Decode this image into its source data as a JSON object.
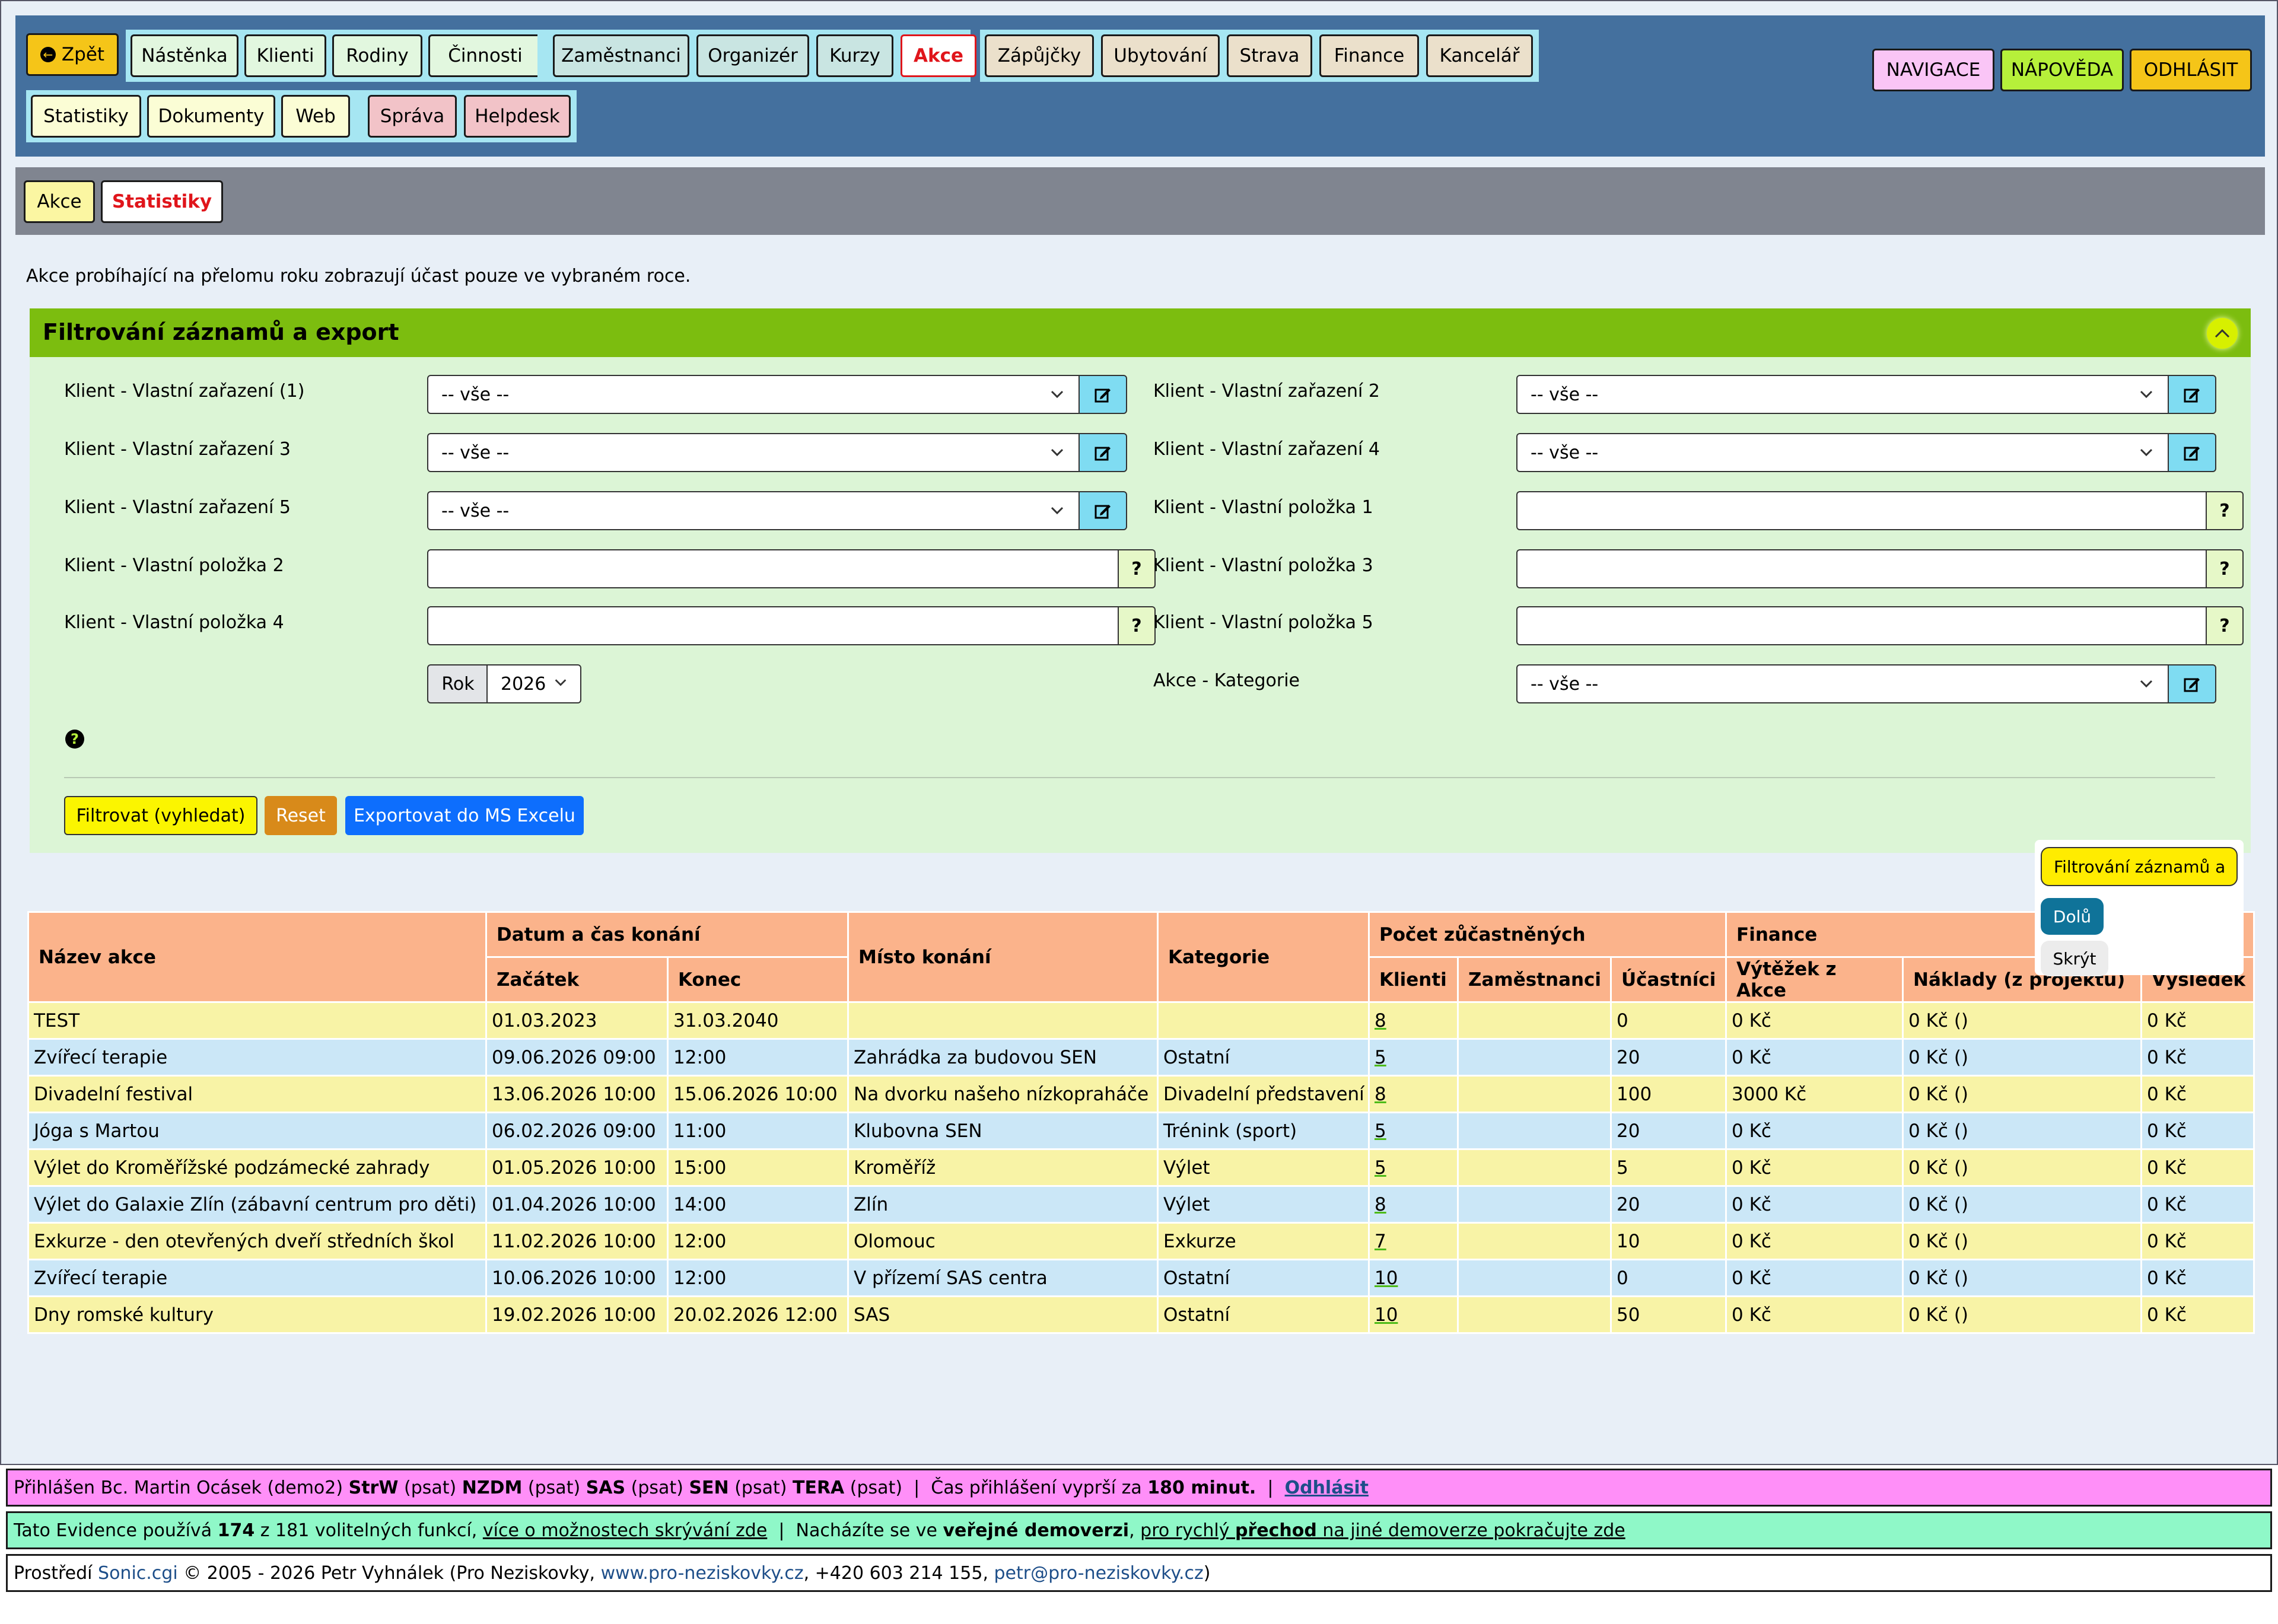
{
  "nav": {
    "back": "Zpět",
    "group1": [
      "Nástěnka",
      "Klienti",
      "Rodiny",
      "Činnosti"
    ],
    "group2": [
      "Zaměstnanci",
      "Organizér",
      "Kurzy",
      "Akce"
    ],
    "group3": [
      "Zápůjčky",
      "Ubytování",
      "Strava",
      "Finance",
      "Kancelář"
    ],
    "group4": [
      "Statistiky",
      "Dokumenty",
      "Web"
    ],
    "group5": [
      "Správa",
      "Helpdesk"
    ],
    "right": [
      "NAVIGACE",
      "NÁPOVĚDA",
      "ODHLÁSIT"
    ],
    "active": "Akce"
  },
  "subnav": {
    "items": [
      "Akce",
      "Statistiky"
    ],
    "active": "Statistiky"
  },
  "notice": "Akce probíhající na přelomu roku zobrazují účast pouze ve vybraném roce.",
  "filter": {
    "title": "Filtrování záznamů a export",
    "fields": {
      "vz1": {
        "label": "Klient - Vlastní zařazení (1)",
        "value": "-- vše --"
      },
      "vz2": {
        "label": "Klient - Vlastní zařazení 2",
        "value": "-- vše --"
      },
      "vz3": {
        "label": "Klient - Vlastní zařazení 3",
        "value": "-- vše --"
      },
      "vz4": {
        "label": "Klient - Vlastní zařazení 4",
        "value": "-- vše --"
      },
      "vz5": {
        "label": "Klient - Vlastní zařazení 5",
        "value": "-- vše --"
      },
      "vp1": {
        "label": "Klient - Vlastní položka 1",
        "value": ""
      },
      "vp2": {
        "label": "Klient - Vlastní položka 2",
        "value": ""
      },
      "vp3": {
        "label": "Klient - Vlastní položka 3",
        "value": ""
      },
      "vp4": {
        "label": "Klient - Vlastní položka 4",
        "value": ""
      },
      "vp5": {
        "label": "Klient - Vlastní položka 5",
        "value": ""
      },
      "rok": {
        "label": "Rok",
        "value": "2026"
      },
      "kat": {
        "label": "Akce - Kategorie",
        "value": "-- vše --"
      }
    },
    "help_glyph": "?",
    "buttons": {
      "filter": "Filtrovat (vyhledat)",
      "reset": "Reset",
      "export": "Exportovat do MS Excelu"
    }
  },
  "popup": {
    "title": "Filtrování záznamů a",
    "down": "Dolů",
    "hide": "Skrýt"
  },
  "table": {
    "headers": {
      "name": "Název akce",
      "datetime": "Datum a čas konání",
      "start": "Začátek",
      "end": "Konec",
      "place": "Místo konání",
      "category": "Kategorie",
      "participants": "Počet zůčastněných",
      "clients": "Klienti",
      "staff": "Zaměstnanci",
      "attendees": "Účastníci",
      "finance": "Finance",
      "revenue": "Výtěžek z Akce",
      "costs": "Náklady (z projektu)",
      "result": "Výsledek"
    },
    "rows": [
      [
        "TEST",
        "01.03.2023",
        "31.03.2040",
        "",
        "",
        "8",
        "",
        "0",
        "0 Kč",
        "0 Kč ()",
        "0 Kč"
      ],
      [
        "Zvířecí terapie",
        "09.06.2026 09:00",
        "12:00",
        "Zahrádka za budovou SEN",
        "Ostatní",
        "5",
        "",
        "20",
        "0 Kč",
        "0 Kč ()",
        "0 Kč"
      ],
      [
        "Divadelní festival",
        "13.06.2026 10:00",
        "15.06.2026 10:00",
        "Na dvorku našeho nízkopraháče",
        "Divadelní představení",
        "8",
        "",
        "100",
        "3000 Kč",
        "0 Kč ()",
        "0 Kč"
      ],
      [
        "Jóga s Martou",
        "06.02.2026 09:00",
        "11:00",
        "Klubovna SEN",
        "Trénink (sport)",
        "5",
        "",
        "20",
        "0 Kč",
        "0 Kč ()",
        "0 Kč"
      ],
      [
        "Výlet do Kroměřížské podzámecké zahrady",
        "01.05.2026 10:00",
        "15:00",
        "Kroměříž",
        "Výlet",
        "5",
        "",
        "5",
        "0 Kč",
        "0 Kč ()",
        "0 Kč"
      ],
      [
        "Výlet do Galaxie Zlín (zábavní centrum pro děti)",
        "01.04.2026 10:00",
        "14:00",
        "Zlín",
        "Výlet",
        "8",
        "",
        "20",
        "0 Kč",
        "0 Kč ()",
        "0 Kč"
      ],
      [
        "Exkurze - den otevřených dveří středních škol",
        "11.02.2026 10:00",
        "12:00",
        "Olomouc",
        "Exkurze",
        "7",
        "",
        "10",
        "0 Kč",
        "0 Kč ()",
        "0 Kč"
      ],
      [
        "Zvířecí terapie",
        "10.06.2026 10:00",
        "12:00",
        "V přízemí SAS centra",
        "Ostatní",
        "10",
        "",
        "0",
        "0 Kč",
        "0 Kč ()",
        "0 Kč"
      ],
      [
        "Dny romské kultury",
        "19.02.2026 10:00",
        "20.02.2026 12:00",
        "SAS",
        "Ostatní",
        "10",
        "",
        "50",
        "0 Kč",
        "0 Kč ()",
        "0 Kč"
      ]
    ]
  },
  "footer": {
    "line1": {
      "prefix": "Přihlášen Bc. Martin Ocásek (demo2) ",
      "orgs": [
        {
          "name": "StrW",
          "note": " (psat) "
        },
        {
          "name": "NZDM",
          "note": " (psat) "
        },
        {
          "name": "SAS",
          "note": " (psat) "
        },
        {
          "name": "SEN",
          "note": " (psat) "
        },
        {
          "name": "TERA",
          "note": " (psat) "
        }
      ],
      "sep": " |  Čas přihlášení vyprší za ",
      "minutes": "180 minut.",
      "sep2": "  |  ",
      "logout": "Odhlásit"
    },
    "line2": {
      "a": "Tato Evidence používá ",
      "used": "174",
      "b": " z 181 volitelných funkcí, ",
      "link1": "více o možnostech skrývání zde",
      "c": "  |  Nacházíte se ve ",
      "demo": "veřejné demoverzi",
      "d": ", ",
      "link2a": "pro rychlý ",
      "link2b": "přechod",
      "link2c": " na jiné demoverze pokračujte zde"
    },
    "line3": {
      "a": "Prostředí ",
      "app": "Sonic.cgi",
      "b": " © 2005 - 2026 Petr Vyhnálek (Pro Neziskovky, ",
      "web": "www.pro-neziskovky.cz",
      "c": ", +420 603 214 155, ",
      "mail": "petr@pro-neziskovky.cz",
      "d": ")"
    }
  },
  "colors": {
    "topnav": "#44709e",
    "filter_header": "#7cbd0f",
    "row_odd": "#f8f3a6",
    "row_even": "#cbe7f7",
    "table_header": "#fbb38b"
  }
}
